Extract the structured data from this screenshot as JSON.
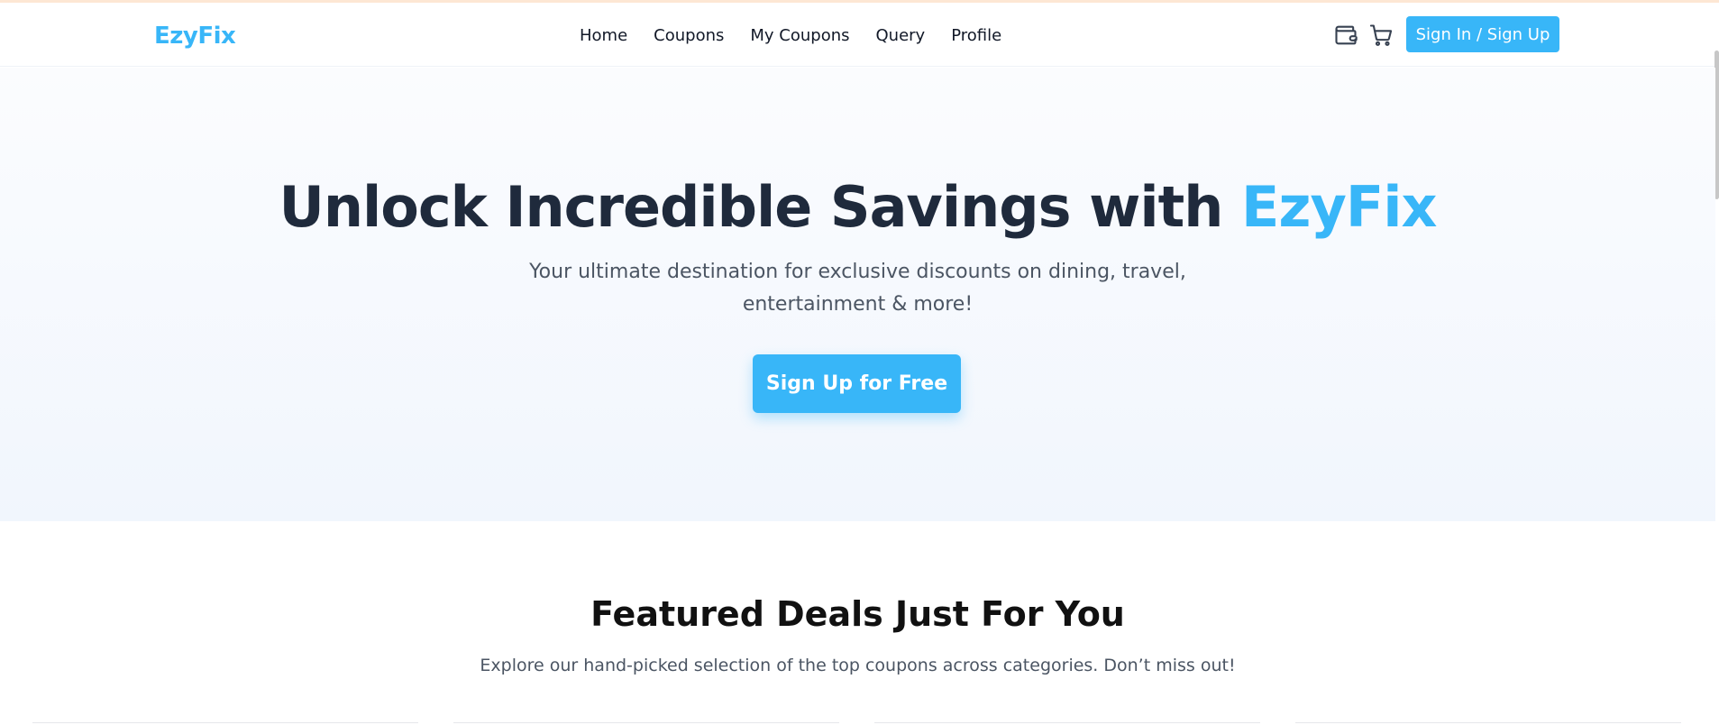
{
  "header": {
    "brand": "EzyFix",
    "nav": [
      {
        "label": "Home"
      },
      {
        "label": "Coupons"
      },
      {
        "label": "My Coupons"
      },
      {
        "label": "Query"
      },
      {
        "label": "Profile"
      }
    ],
    "icons": [
      "wallet-icon",
      "cart-icon"
    ],
    "signin_label": "Sign In / Sign Up"
  },
  "hero": {
    "title_main": "Unlock Incredible Savings with ",
    "title_accent": "EzyFix",
    "subtitle": "Your ultimate destination for exclusive discounts on dining, travel, entertainment & more!",
    "cta_label": "Sign Up for Free"
  },
  "featured": {
    "title": "Featured Deals Just For You",
    "subtitle": "Explore our hand-picked selection of the top coupons across categories. Don’t miss out!"
  },
  "colors": {
    "accent": "#38b6f8",
    "heading": "#1f2a3c",
    "body_text": "#4b5563"
  }
}
